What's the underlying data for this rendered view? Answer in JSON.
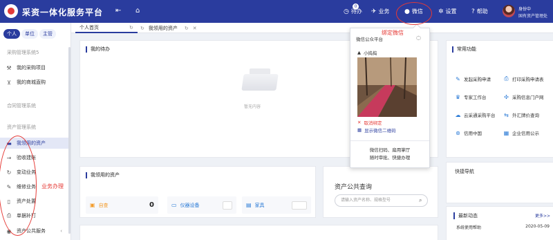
{
  "app": {
    "title": "采资一体化服务平台"
  },
  "header": {
    "todo": {
      "label": "待办",
      "badge": "0"
    },
    "business": {
      "label": "业务"
    },
    "wechat": {
      "label": "微信"
    },
    "settings": {
      "label": "设置"
    },
    "help": {
      "label": "帮助"
    },
    "user": {
      "name": "身份中",
      "org": "国有资产管理处"
    }
  },
  "sidebar": {
    "tabs": [
      {
        "label": "个人",
        "active": true
      },
      {
        "label": "单位",
        "active": false
      },
      {
        "label": "主管",
        "active": false
      }
    ],
    "groups": {
      "procurement": "采购管理系统5",
      "contract": "合同管理系统",
      "asset": "资产管理系统"
    },
    "procurement_items": [
      {
        "label": "我的采购项目",
        "icon": "gavel-icon"
      },
      {
        "label": "我的商城直购",
        "icon": "cart-icon"
      }
    ],
    "asset_items": [
      {
        "label": "我领用的资产",
        "icon": "folder-icon",
        "active": true
      },
      {
        "label": "验收建账",
        "icon": "arrow-icon"
      },
      {
        "label": "变动业务",
        "icon": "refresh-icon"
      },
      {
        "label": "维修业务",
        "icon": "wrench-icon"
      },
      {
        "label": "资产处置",
        "icon": "trash-icon"
      },
      {
        "label": "单据补打",
        "icon": "printer-icon"
      },
      {
        "label": "资产公共服务",
        "icon": "service-icon"
      }
    ]
  },
  "tabs": [
    {
      "label": "个人首页",
      "active": true
    },
    {
      "label": "我领用的资产",
      "active": false
    }
  ],
  "todo_panel": {
    "title": "我的待办",
    "empty_text": "暂无内容"
  },
  "assets_panel": {
    "title": "我领用的资产",
    "stats": [
      {
        "label": "自查",
        "value": "0"
      },
      {
        "label": "仪器设备",
        "value": ""
      },
      {
        "label": "家具",
        "value": ""
      }
    ]
  },
  "asset_query": {
    "title": "资产公共查询",
    "placeholder": "请输入资产名称、规格型号"
  },
  "frequent": {
    "title": "常用功能",
    "items": [
      {
        "label": "发起采购申请",
        "icon": "pen-icon"
      },
      {
        "label": "打印采购申请表",
        "icon": "print-icon"
      },
      {
        "label": "专家工作台",
        "icon": "expert-icon"
      },
      {
        "label": "采购信息门户网",
        "icon": "portal-icon"
      },
      {
        "label": "云采通采购平台",
        "icon": "cloud-icon"
      },
      {
        "label": "外汇牌价查询",
        "icon": "exchange-icon"
      },
      {
        "label": "信用中国",
        "icon": "credit-icon"
      },
      {
        "label": "企业信用公示",
        "icon": "enterprise-icon"
      }
    ]
  },
  "quick_nav": {
    "title": "快捷导航"
  },
  "news": {
    "title": "最新动态",
    "more": "更多>>",
    "items": [
      {
        "label": "系统使用帮助",
        "date": "2020-05-09"
      }
    ]
  },
  "wechat_popup": {
    "header": "微信公众平台",
    "username": "小捣捣",
    "unbind": "取消绑定",
    "show_qr": "显示微信二维码",
    "footer_line1": "微信扫码、扁用掌厅",
    "footer_line2": "随时审批、快捷办理"
  },
  "annotations": {
    "bind_wechat": "绑定微信",
    "business": "业务办理"
  },
  "colors": {
    "primary": "#2a3c9e",
    "annotation": "#e53935",
    "orange": "#f39c2b"
  }
}
